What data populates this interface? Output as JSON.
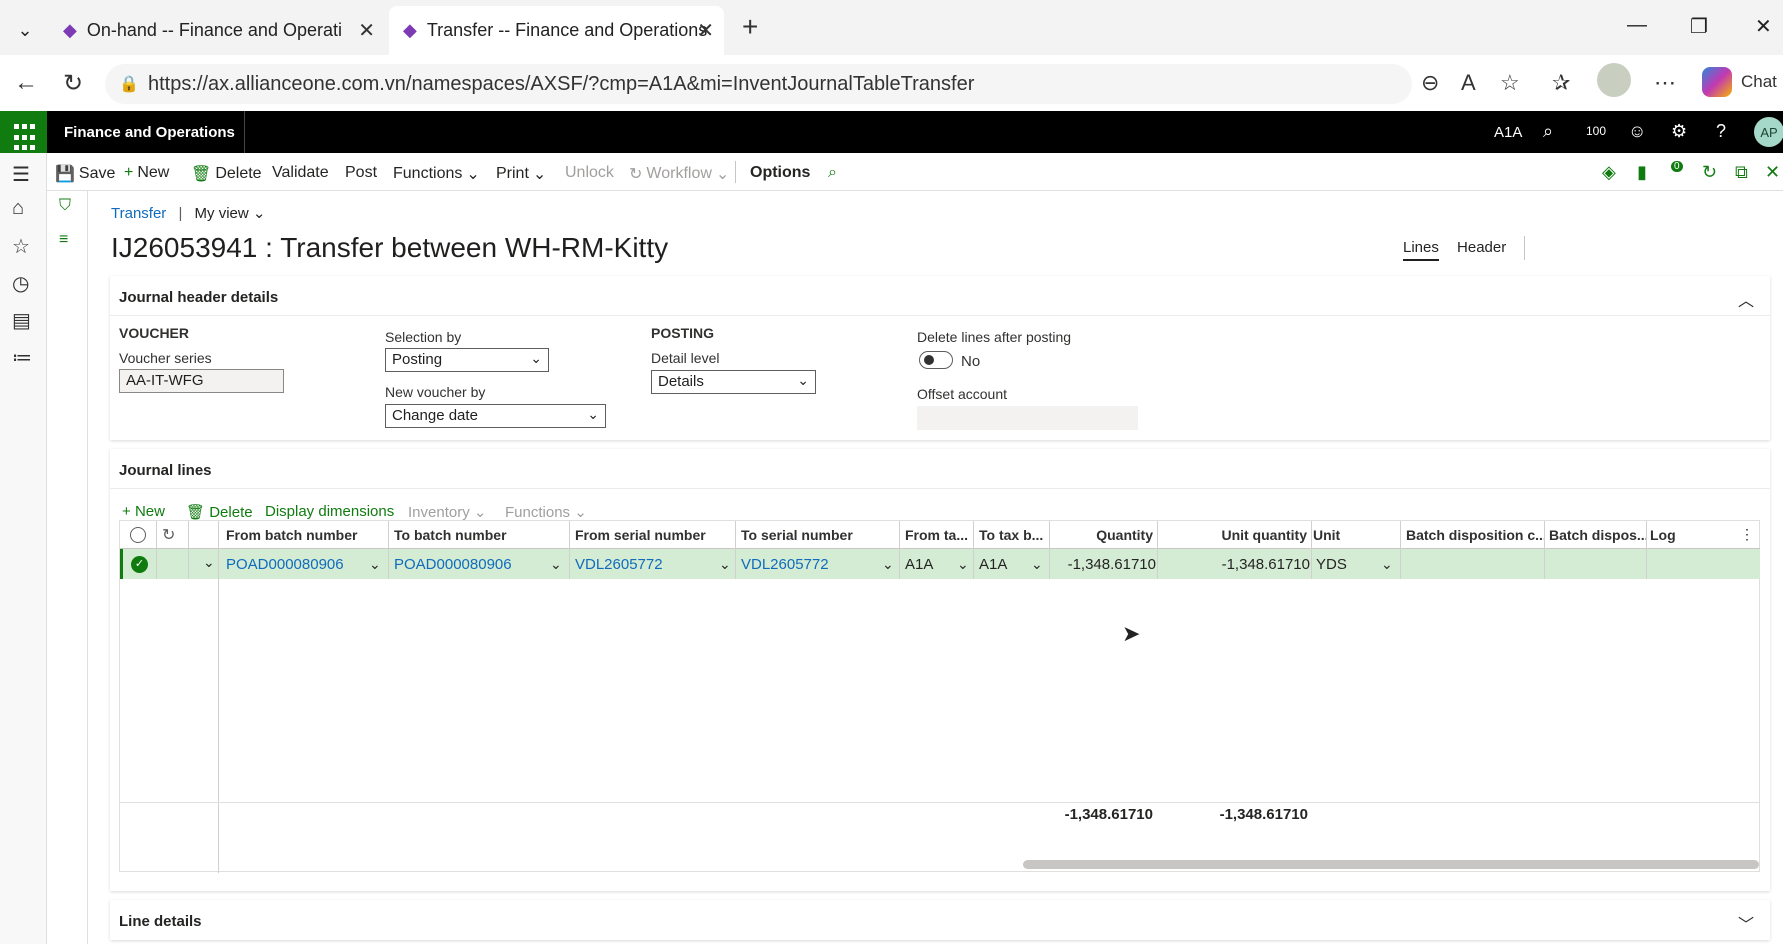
{
  "browser": {
    "tabs": [
      {
        "title": "On-hand -- Finance and Operation"
      },
      {
        "title": "Transfer -- Finance and Operations"
      }
    ],
    "url": "https://ax.allianceone.com.vn/namespaces/AXSF/?cmp=A1A&mi=InventJournalTableTransfer",
    "chat_label": "Chat"
  },
  "app": {
    "name": "Finance and Operations",
    "company": "A1A",
    "notifications": "100",
    "avatar": "AP"
  },
  "actions": {
    "save": "Save",
    "new": "New",
    "delete": "Delete",
    "validate": "Validate",
    "post": "Post",
    "functions": "Functions",
    "print": "Print",
    "unlock": "Unlock",
    "workflow": "Workflow",
    "options": "Options",
    "badge": "0"
  },
  "breadcrumb": {
    "root": "Transfer",
    "sep": "|",
    "view": "My view"
  },
  "page": {
    "title": "IJ26053941 : Transfer between WH-RM-Kitty"
  },
  "view_tabs": {
    "lines": "Lines",
    "header": "Header"
  },
  "header_details": {
    "title": "Journal header details",
    "voucher_group": "VOUCHER",
    "voucher_series_label": "Voucher series",
    "voucher_series": "AA-IT-WFG",
    "selection_by_label": "Selection by",
    "selection_by": "Posting",
    "new_voucher_by_label": "New voucher by",
    "new_voucher_by": "Change date",
    "posting_group": "POSTING",
    "detail_level_label": "Detail level",
    "detail_level": "Details",
    "delete_lines_label": "Delete lines after posting",
    "delete_lines_value": "No",
    "offset_account_label": "Offset account",
    "offset_account": ""
  },
  "journal_lines": {
    "title": "Journal lines",
    "toolbar": {
      "new": "New",
      "delete": "Delete",
      "display_dimensions": "Display dimensions",
      "inventory": "Inventory",
      "functions": "Functions"
    },
    "columns": [
      "From batch number",
      "To batch number",
      "From serial number",
      "To serial number",
      "From ta...",
      "To tax b...",
      "Quantity",
      "Unit quantity",
      "Unit",
      "Batch disposition c...",
      "Batch dispos...",
      "Log"
    ],
    "rows": [
      {
        "from_batch": "POAD000080906",
        "to_batch": "POAD000080906",
        "from_serial": "VDL2605772",
        "to_serial": "VDL2605772",
        "from_tax": "A1A",
        "to_tax": "A1A",
        "quantity": "-1,348.61710",
        "unit_quantity": "-1,348.61710",
        "unit": "YDS",
        "batch_disp_code": "",
        "batch_disp": "",
        "log": ""
      }
    ],
    "totals": {
      "quantity": "-1,348.61710",
      "unit_quantity": "-1,348.61710"
    }
  },
  "line_details": {
    "title": "Line details"
  }
}
